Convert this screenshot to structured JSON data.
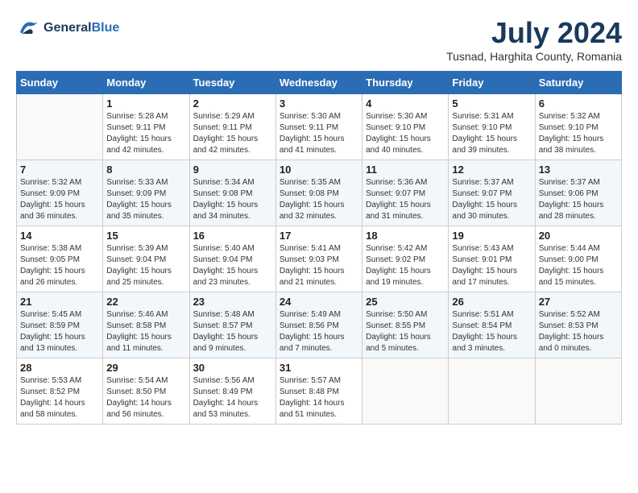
{
  "header": {
    "logo_line1": "General",
    "logo_line2": "Blue",
    "month_year": "July 2024",
    "location": "Tusnad, Harghita County, Romania"
  },
  "weekdays": [
    "Sunday",
    "Monday",
    "Tuesday",
    "Wednesday",
    "Thursday",
    "Friday",
    "Saturday"
  ],
  "weeks": [
    [
      {
        "day": "",
        "info": ""
      },
      {
        "day": "1",
        "info": "Sunrise: 5:28 AM\nSunset: 9:11 PM\nDaylight: 15 hours\nand 42 minutes."
      },
      {
        "day": "2",
        "info": "Sunrise: 5:29 AM\nSunset: 9:11 PM\nDaylight: 15 hours\nand 42 minutes."
      },
      {
        "day": "3",
        "info": "Sunrise: 5:30 AM\nSunset: 9:11 PM\nDaylight: 15 hours\nand 41 minutes."
      },
      {
        "day": "4",
        "info": "Sunrise: 5:30 AM\nSunset: 9:10 PM\nDaylight: 15 hours\nand 40 minutes."
      },
      {
        "day": "5",
        "info": "Sunrise: 5:31 AM\nSunset: 9:10 PM\nDaylight: 15 hours\nand 39 minutes."
      },
      {
        "day": "6",
        "info": "Sunrise: 5:32 AM\nSunset: 9:10 PM\nDaylight: 15 hours\nand 38 minutes."
      }
    ],
    [
      {
        "day": "7",
        "info": "Sunrise: 5:32 AM\nSunset: 9:09 PM\nDaylight: 15 hours\nand 36 minutes."
      },
      {
        "day": "8",
        "info": "Sunrise: 5:33 AM\nSunset: 9:09 PM\nDaylight: 15 hours\nand 35 minutes."
      },
      {
        "day": "9",
        "info": "Sunrise: 5:34 AM\nSunset: 9:08 PM\nDaylight: 15 hours\nand 34 minutes."
      },
      {
        "day": "10",
        "info": "Sunrise: 5:35 AM\nSunset: 9:08 PM\nDaylight: 15 hours\nand 32 minutes."
      },
      {
        "day": "11",
        "info": "Sunrise: 5:36 AM\nSunset: 9:07 PM\nDaylight: 15 hours\nand 31 minutes."
      },
      {
        "day": "12",
        "info": "Sunrise: 5:37 AM\nSunset: 9:07 PM\nDaylight: 15 hours\nand 30 minutes."
      },
      {
        "day": "13",
        "info": "Sunrise: 5:37 AM\nSunset: 9:06 PM\nDaylight: 15 hours\nand 28 minutes."
      }
    ],
    [
      {
        "day": "14",
        "info": "Sunrise: 5:38 AM\nSunset: 9:05 PM\nDaylight: 15 hours\nand 26 minutes."
      },
      {
        "day": "15",
        "info": "Sunrise: 5:39 AM\nSunset: 9:04 PM\nDaylight: 15 hours\nand 25 minutes."
      },
      {
        "day": "16",
        "info": "Sunrise: 5:40 AM\nSunset: 9:04 PM\nDaylight: 15 hours\nand 23 minutes."
      },
      {
        "day": "17",
        "info": "Sunrise: 5:41 AM\nSunset: 9:03 PM\nDaylight: 15 hours\nand 21 minutes."
      },
      {
        "day": "18",
        "info": "Sunrise: 5:42 AM\nSunset: 9:02 PM\nDaylight: 15 hours\nand 19 minutes."
      },
      {
        "day": "19",
        "info": "Sunrise: 5:43 AM\nSunset: 9:01 PM\nDaylight: 15 hours\nand 17 minutes."
      },
      {
        "day": "20",
        "info": "Sunrise: 5:44 AM\nSunset: 9:00 PM\nDaylight: 15 hours\nand 15 minutes."
      }
    ],
    [
      {
        "day": "21",
        "info": "Sunrise: 5:45 AM\nSunset: 8:59 PM\nDaylight: 15 hours\nand 13 minutes."
      },
      {
        "day": "22",
        "info": "Sunrise: 5:46 AM\nSunset: 8:58 PM\nDaylight: 15 hours\nand 11 minutes."
      },
      {
        "day": "23",
        "info": "Sunrise: 5:48 AM\nSunset: 8:57 PM\nDaylight: 15 hours\nand 9 minutes."
      },
      {
        "day": "24",
        "info": "Sunrise: 5:49 AM\nSunset: 8:56 PM\nDaylight: 15 hours\nand 7 minutes."
      },
      {
        "day": "25",
        "info": "Sunrise: 5:50 AM\nSunset: 8:55 PM\nDaylight: 15 hours\nand 5 minutes."
      },
      {
        "day": "26",
        "info": "Sunrise: 5:51 AM\nSunset: 8:54 PM\nDaylight: 15 hours\nand 3 minutes."
      },
      {
        "day": "27",
        "info": "Sunrise: 5:52 AM\nSunset: 8:53 PM\nDaylight: 15 hours\nand 0 minutes."
      }
    ],
    [
      {
        "day": "28",
        "info": "Sunrise: 5:53 AM\nSunset: 8:52 PM\nDaylight: 14 hours\nand 58 minutes."
      },
      {
        "day": "29",
        "info": "Sunrise: 5:54 AM\nSunset: 8:50 PM\nDaylight: 14 hours\nand 56 minutes."
      },
      {
        "day": "30",
        "info": "Sunrise: 5:56 AM\nSunset: 8:49 PM\nDaylight: 14 hours\nand 53 minutes."
      },
      {
        "day": "31",
        "info": "Sunrise: 5:57 AM\nSunset: 8:48 PM\nDaylight: 14 hours\nand 51 minutes."
      },
      {
        "day": "",
        "info": ""
      },
      {
        "day": "",
        "info": ""
      },
      {
        "day": "",
        "info": ""
      }
    ]
  ]
}
